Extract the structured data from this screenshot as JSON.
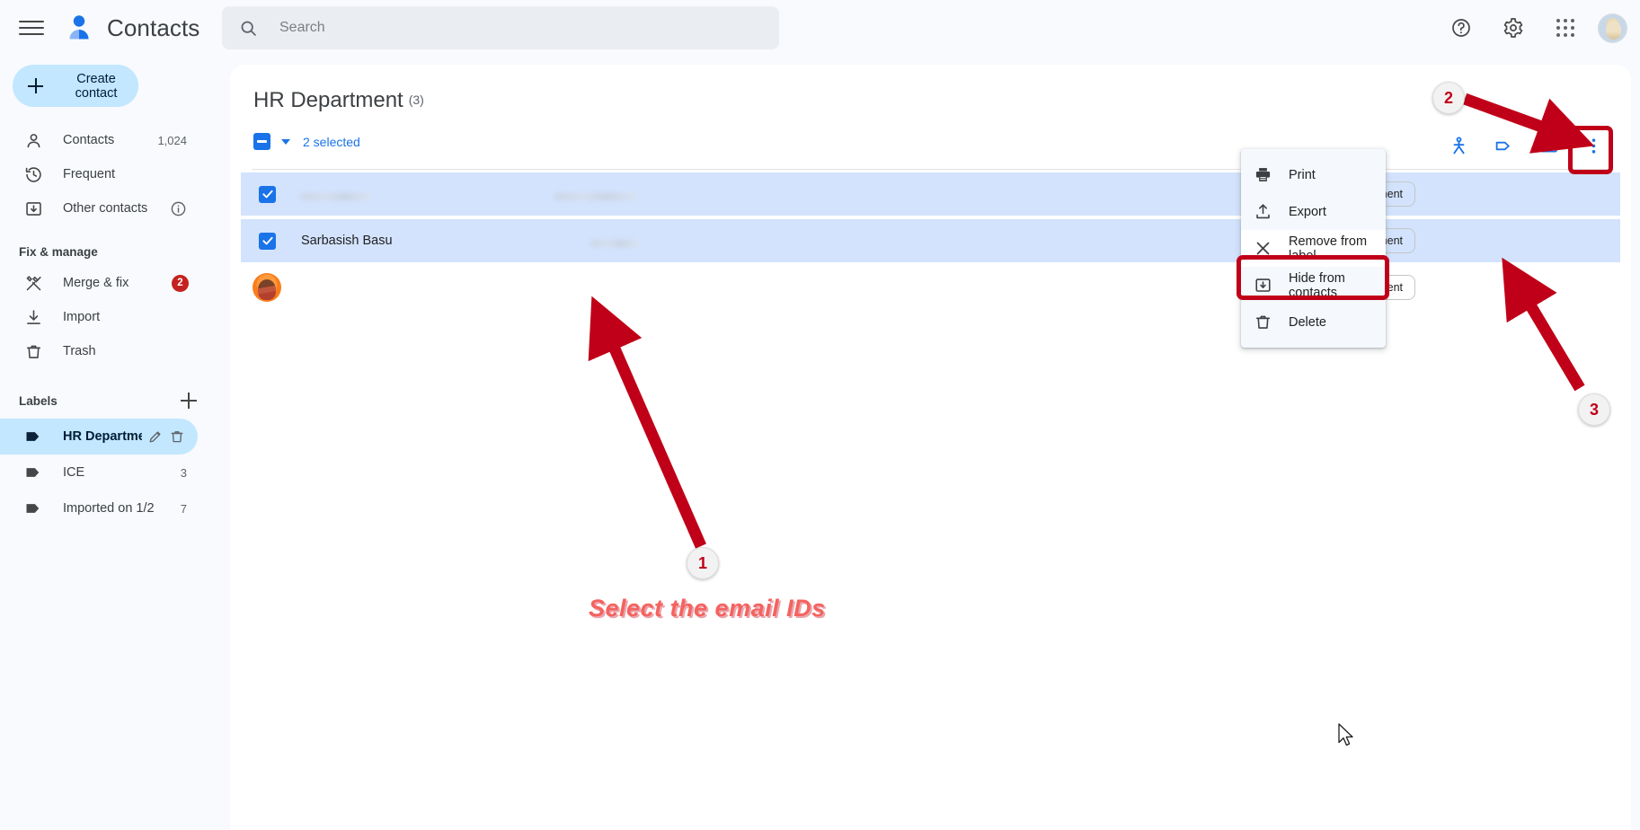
{
  "app": {
    "title": "Contacts",
    "brand_icon": "contacts-person-icon",
    "menu_icon": "hamburger-menu-icon"
  },
  "search": {
    "placeholder": "Search",
    "value": "",
    "icon": "search-icon"
  },
  "topbar_actions": [
    {
      "name": "help-icon",
      "label": "Help"
    },
    {
      "name": "settings-gear-icon",
      "label": "Settings"
    },
    {
      "name": "google-apps-icon",
      "label": "Google apps"
    },
    {
      "name": "account-avatar",
      "label": "Google Account"
    }
  ],
  "sidebar": {
    "create_button": {
      "label": "Create contact",
      "icon": "plus-icon"
    },
    "items": [
      {
        "label": "Contacts",
        "count": "1,024",
        "icon": "person-icon",
        "selected": false
      },
      {
        "label": "Frequent",
        "count": "",
        "icon": "history-clock-icon",
        "selected": false
      },
      {
        "label": "Other contacts",
        "count": "",
        "icon": "inbox-down-arrow-icon",
        "info": true,
        "selected": false
      }
    ],
    "fix_manage": {
      "heading": "Fix & manage",
      "items": [
        {
          "label": "Merge & fix",
          "badge": "2",
          "icon": "hammer-wrench-icon"
        },
        {
          "label": "Import",
          "badge": "",
          "icon": "download-icon"
        },
        {
          "label": "Trash",
          "badge": "",
          "icon": "trash-icon"
        }
      ]
    },
    "labels": {
      "heading": "Labels",
      "add_icon": "plus-icon",
      "items": [
        {
          "label": "HR Department",
          "count": "",
          "selected": true,
          "edit_icon": "pencil-icon",
          "delete_icon": "trash-icon"
        },
        {
          "label": "ICE",
          "count": "3",
          "selected": false
        },
        {
          "label": "Imported on 1/2",
          "count": "7",
          "selected": false
        }
      ]
    }
  },
  "main": {
    "page_title": "HR Department",
    "page_count": "(3)",
    "selection": {
      "state": "indeterminate",
      "text": "2 selected",
      "caret_icon": "chevron-down-icon"
    },
    "toolbar_icons": [
      {
        "name": "merge-contacts-icon",
        "label": "Merge"
      },
      {
        "name": "label-tag-icon",
        "label": "Manage labels"
      },
      {
        "name": "email-envelope-icon",
        "label": "Send email"
      },
      {
        "name": "more-vert-icon",
        "label": "More actions"
      }
    ],
    "chip_label": "HR Department",
    "rows": [
      {
        "name": "",
        "name_blurred": true,
        "email": "",
        "email_blurred": true,
        "checked": true,
        "avatar": false,
        "chip": "HR Department"
      },
      {
        "name": "Sarbasish Basu",
        "name_blurred": false,
        "email": "",
        "email_blurred": true,
        "checked": true,
        "avatar": false,
        "chip": "HR Department"
      },
      {
        "name": "",
        "name_blurred": true,
        "email": "",
        "email_blurred": true,
        "checked": false,
        "avatar": true,
        "chip": "HR Department"
      }
    ]
  },
  "context_menu": {
    "items": [
      {
        "label": "Print",
        "icon": "printer-icon",
        "highlighted": false
      },
      {
        "label": "Export",
        "icon": "upload-export-icon",
        "highlighted": false
      },
      {
        "label": "Remove from label",
        "icon": "close-x-icon",
        "highlighted": true
      },
      {
        "label": "Hide from contacts",
        "icon": "hide-archive-icon",
        "highlighted": false
      },
      {
        "label": "Delete",
        "icon": "trash-icon",
        "highlighted": false
      }
    ]
  },
  "annotations": {
    "accent_color": "#c00018",
    "callout_color": "#f4635f",
    "steps": [
      {
        "number": "1",
        "text": "Select the email IDs"
      },
      {
        "number": "2",
        "text": ""
      },
      {
        "number": "3",
        "text": ""
      }
    ],
    "callout_text": "Select the email IDs"
  }
}
